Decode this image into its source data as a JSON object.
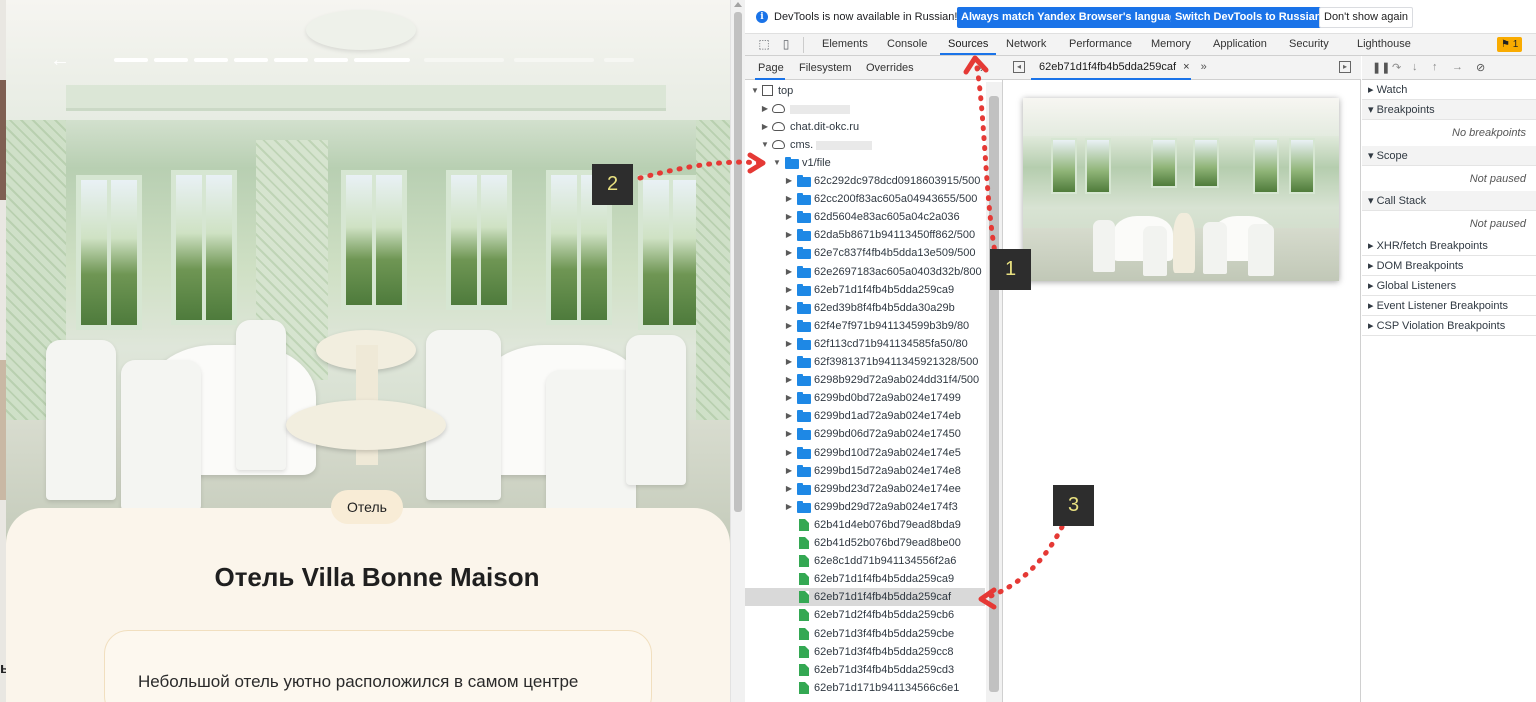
{
  "hotel_page": {
    "back_arrow": "←",
    "category_tag": "Отель",
    "title": "Отель Villa Bonne Maison",
    "description_start": "Небольшой отель уютно расположился в самом центре",
    "cut_char": "ь",
    "gallery_progress": {
      "total_segments": 10,
      "viewed_segments": 6
    }
  },
  "devtools": {
    "infobar": {
      "message": "DevTools is now available in Russian!",
      "btn_match": "Always match Yandex Browser's language",
      "btn_switch": "Switch DevTools to Russian",
      "btn_dismiss": "Don't show again"
    },
    "tabs": [
      "Elements",
      "Console",
      "Sources",
      "Network",
      "Performance",
      "Memory",
      "Application",
      "Security",
      "Lighthouse"
    ],
    "active_tab": "Sources",
    "issues_count": "1",
    "navigator_tabs": [
      "Page",
      "Filesystem",
      "Overrides"
    ],
    "navigator_more": "»",
    "editor_tab": "62eb71d1f4fb4b5dda259caf",
    "editor_tab_close": "×",
    "editor_more": "»",
    "tree": {
      "top": "top",
      "host_chat": "chat.dit-okc.ru",
      "host_cms": "cms.",
      "folder_v1": "v1/file",
      "folders": [
        "62c292dc978dcd0918603915/500",
        "62cc200f83ac605a04943655/500",
        "62d5604e83ac605a04c2a036",
        "62da5b8671b94113450ff862/500",
        "62e7c837f4fb4b5dda13e509/500",
        "62e2697183ac605a0403d32b/800",
        "62eb71d1f4fb4b5dda259ca9",
        "62ed39b8f4fb4b5dda30a29b",
        "62f4e7f971b941134599b3b9/80",
        "62f113cd71b941134585fa50/80",
        "62f3981371b9411345921328/500",
        "6298b929d72a9ab024dd31f4/500",
        "6299bd0bd72a9ab024e17499",
        "6299bd1ad72a9ab024e174eb",
        "6299bd06d72a9ab024e17450",
        "6299bd10d72a9ab024e174e5",
        "6299bd15d72a9ab024e174e8",
        "6299bd23d72a9ab024e174ee",
        "6299bd29d72a9ab024e174f3"
      ],
      "files": [
        "62b41d4eb076bd79ead8bda9",
        "62b41d52b076bd79ead8be00",
        "62e8c1dd71b941134556f2a6",
        "62eb71d1f4fb4b5dda259ca9",
        "62eb71d1f4fb4b5dda259caf",
        "62eb71d2f4fb4b5dda259cb6",
        "62eb71d3f4fb4b5dda259cbe",
        "62eb71d3f4fb4b5dda259cc8",
        "62eb71d3f4fb4b5dda259cd3",
        "62eb71d171b941134566c6e1"
      ],
      "selected_file": "62eb71d1f4fb4b5dda259caf"
    },
    "debugger": {
      "watch": "Watch",
      "breakpoints": "Breakpoints",
      "no_breakpoints": "No breakpoints",
      "scope": "Scope",
      "scope_state": "Not paused",
      "call_stack": "Call Stack",
      "call_stack_state": "Not paused",
      "xhr": "XHR/fetch Breakpoints",
      "dom": "DOM Breakpoints",
      "global": "Global Listeners",
      "event": "Event Listener Breakpoints",
      "csp": "CSP Violation Breakpoints"
    }
  },
  "annotations": {
    "badge1": "1",
    "badge2": "2",
    "badge3": "3",
    "arrow_color": "#e53935"
  },
  "colors": {
    "accent": "#1a73e8",
    "folder": "#1e88e5",
    "file": "#34a853",
    "card_bg": "#fbf5eb",
    "tag_bg": "#f8ecd6"
  }
}
